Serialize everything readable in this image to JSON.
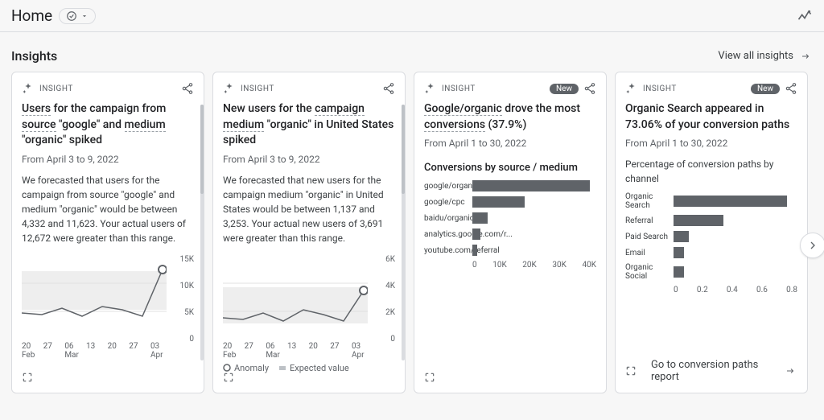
{
  "header": {
    "title": "Home"
  },
  "section": {
    "title": "Insights",
    "view_all": "View all insights"
  },
  "cards": {
    "c1": {
      "label": "INSIGHT",
      "title_parts": [
        "Users",
        " for the campaign from ",
        "source",
        " \"google\" and ",
        "medium",
        " \"organic\" spiked"
      ],
      "title_links": [
        0,
        2,
        4
      ],
      "date": "From April 3 to 9, 2022",
      "body": "We forecasted that users for the campaign from source \"google\" and medium \"organic\" would be between 4,332 and 11,623. Your actual users of 12,672 were greater than this range."
    },
    "c2": {
      "label": "INSIGHT",
      "title_parts": [
        "New users for the ",
        "campaign medium",
        " \"organic\" in United States spiked"
      ],
      "title_links": [
        1
      ],
      "date": "From April 3 to 9, 2022",
      "body": "We forecasted that new users for the campaign medium \"organic\" in United States would be between 1,137 and 3,253. Your actual new users of 3,691 were greater than this range."
    },
    "c3": {
      "label": "INSIGHT",
      "new": "New",
      "title_parts": [
        "Google/organic",
        " drove the most ",
        "conversions",
        " (37.9%)"
      ],
      "title_links": [
        0,
        2
      ],
      "date": "From April 1 to 30, 2022",
      "sub": "Conversions by source / medium"
    },
    "c4": {
      "label": "INSIGHT",
      "new": "New",
      "title": "Organic Search appeared in 73.06% of your conversion paths",
      "date": "From April 1 to 30, 2022",
      "sub": "Percentage of conversion paths by channel",
      "cta": "Go to conversion paths report"
    }
  },
  "legend": {
    "anomaly": "Anomaly",
    "expected": "Expected value"
  },
  "chart_data": [
    {
      "type": "line",
      "id": "card1",
      "x_labels": [
        "20 Feb",
        "27",
        "06 Mar",
        "13",
        "20",
        "27",
        "03 Apr"
      ],
      "y_ticks": [
        "15K",
        "10K",
        "5K",
        "0"
      ],
      "series": [
        {
          "name": "Users",
          "values": [
            5500,
            5200,
            6500,
            5000,
            6800,
            6200,
            5000,
            12672
          ]
        }
      ],
      "expected_band": {
        "low": 4332,
        "high": 11623
      },
      "anomaly_index": 7,
      "ylim": [
        0,
        15000
      ]
    },
    {
      "type": "line",
      "id": "card2",
      "x_labels": [
        "20 Feb",
        "27",
        "06 Mar",
        "13",
        "20",
        "27",
        "03 Apr"
      ],
      "y_ticks": [
        "6K",
        "4K",
        "2K",
        "0"
      ],
      "series": [
        {
          "name": "New users",
          "values": [
            1800,
            1700,
            2100,
            1600,
            2300,
            2000,
            1600,
            3691
          ]
        }
      ],
      "expected_band": {
        "low": 1137,
        "high": 3253
      },
      "anomaly_index": 7,
      "ylim": [
        0,
        6000
      ]
    },
    {
      "type": "bar",
      "id": "card3",
      "categories": [
        "google/organic",
        "google/cpc",
        "baidu/organic",
        "analytics.google.com/r...",
        "youtube.com/referral"
      ],
      "values": [
        38000,
        17000,
        5000,
        2500,
        1500
      ],
      "x_ticks": [
        "0",
        "10K",
        "20K",
        "30K",
        "40K"
      ],
      "xlim": [
        0,
        40000
      ]
    },
    {
      "type": "bar",
      "id": "card4",
      "categories": [
        "Organic Search",
        "Referral",
        "Paid Search",
        "Email",
        "Organic Social"
      ],
      "values": [
        0.73,
        0.32,
        0.1,
        0.07,
        0.07
      ],
      "x_ticks": [
        "0",
        "0.2",
        "0.4",
        "0.6",
        "0.8"
      ],
      "xlim": [
        0,
        0.8
      ]
    }
  ]
}
